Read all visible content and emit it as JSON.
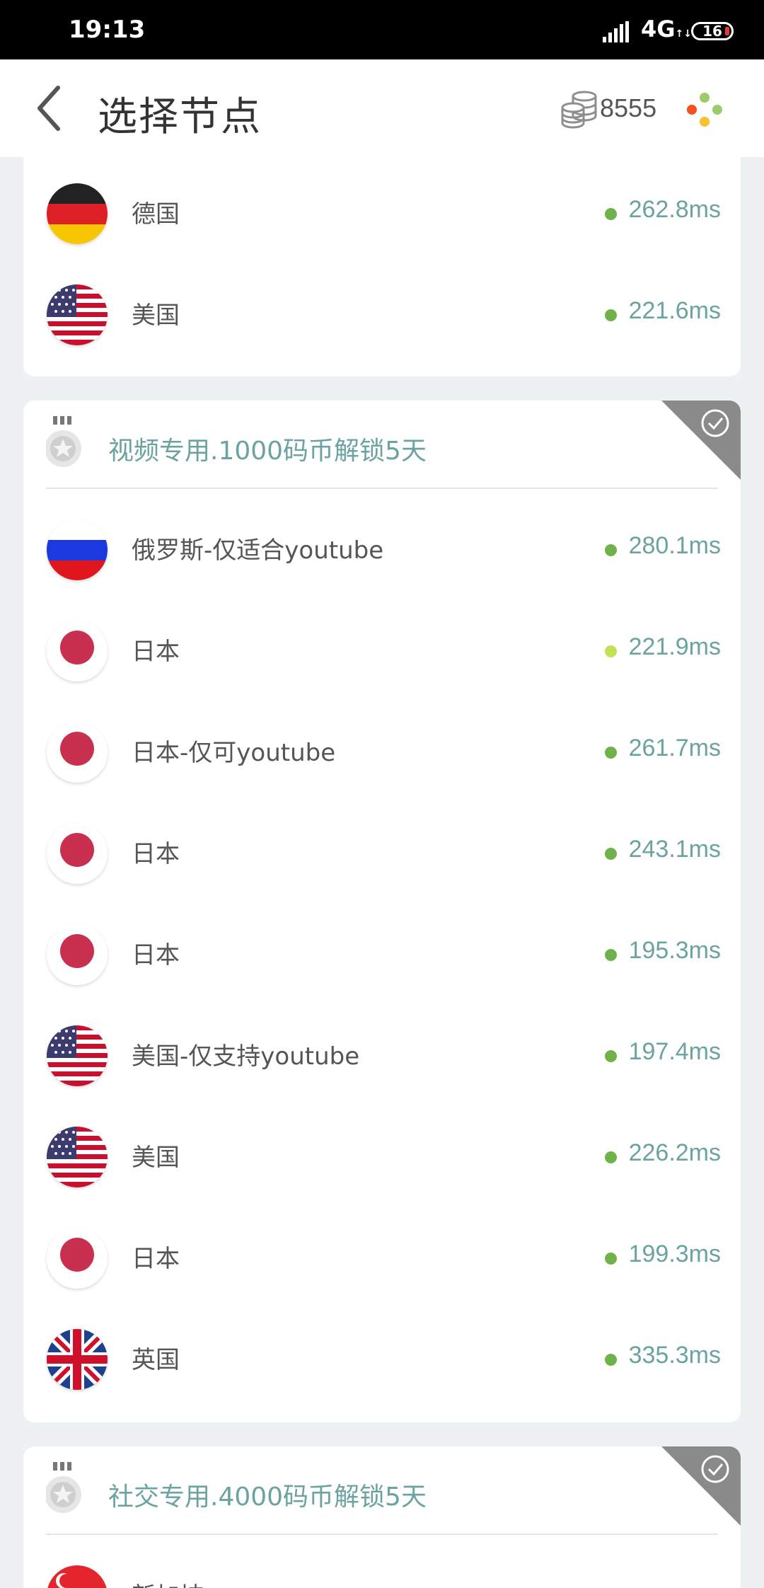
{
  "status_bar": {
    "time": "19:13",
    "network": "4G",
    "battery": "16"
  },
  "header": {
    "title": "选择节点",
    "coins": "8555"
  },
  "top_card": {
    "servers": [
      {
        "name": "德国",
        "ping": "262.8ms",
        "flag": "de"
      },
      {
        "name": "美国",
        "ping": "221.6ms",
        "flag": "us"
      }
    ]
  },
  "video_section": {
    "title": "视频专用.1000码币解锁5天",
    "servers": [
      {
        "name": "俄罗斯-仅适合youtube",
        "ping": "280.1ms",
        "flag": "ru"
      },
      {
        "name": "日本",
        "ping": "221.9ms",
        "flag": "jp",
        "status": "light"
      },
      {
        "name": "日本-仅可youtube",
        "ping": "261.7ms",
        "flag": "jp"
      },
      {
        "name": "日本",
        "ping": "243.1ms",
        "flag": "jp"
      },
      {
        "name": "日本",
        "ping": "195.3ms",
        "flag": "jp"
      },
      {
        "name": "美国-仅支持youtube",
        "ping": "197.4ms",
        "flag": "us"
      },
      {
        "name": "美国",
        "ping": "226.2ms",
        "flag": "us"
      },
      {
        "name": "日本",
        "ping": "199.3ms",
        "flag": "jp"
      },
      {
        "name": "英国",
        "ping": "335.3ms",
        "flag": "gb"
      }
    ]
  },
  "social_section": {
    "title": "社交专用.4000码币解锁5天",
    "servers": [
      {
        "name": "新加坡",
        "flag": "sg"
      }
    ]
  },
  "colors": {
    "accent_teal": "#6aa3a0",
    "ping_dot_green": "#6fb24a",
    "ping_dot_light": "#c5e052",
    "corner_gray": "#8a8a8a"
  }
}
